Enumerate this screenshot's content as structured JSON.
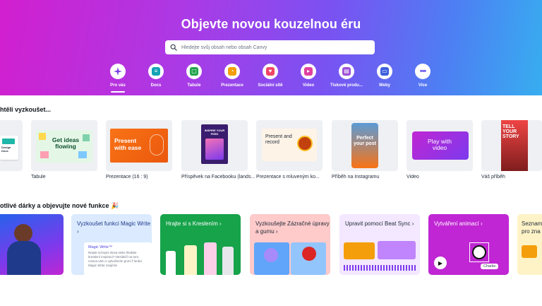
{
  "hero": {
    "title": "Objevte novou kouzelnou éru",
    "search_placeholder": "Hledejte svůj obsah nebo obsah Canvy"
  },
  "nav": [
    {
      "label": "Pro vás",
      "icon": "sparkle-icon",
      "color": "#7b3fe4"
    },
    {
      "label": "Docs",
      "icon": "docs-icon",
      "color": "#13a3b5"
    },
    {
      "label": "Tabule",
      "icon": "whiteboard-icon",
      "color": "#1fa34a"
    },
    {
      "label": "Prezentace",
      "icon": "presentation-icon",
      "color": "#f59e0b"
    },
    {
      "label": "Sociální sítě",
      "icon": "heart-icon",
      "color": "#ef4466"
    },
    {
      "label": "Video",
      "icon": "video-icon",
      "color": "#e040a0"
    },
    {
      "label": "Tiskové produ...",
      "icon": "print-icon",
      "color": "#9b4fd6"
    },
    {
      "label": "Weby",
      "icon": "website-icon",
      "color": "#3d5fdc"
    },
    {
      "label": "Více",
      "icon": "more-icon",
      "color": "#6b62e8"
    }
  ],
  "section1": {
    "title": "htěli vyzkoušet...",
    "cards": [
      {
        "label": "",
        "thumb_text": "Design Docs"
      },
      {
        "label": "Tabule",
        "thumb_text": "Get ideas flowing"
      },
      {
        "label": "Prezentace (16 : 9)",
        "thumb_text": "Present with ease"
      },
      {
        "label": "Příspěvek na Facebooku (lands...",
        "thumb_text": "INSPIRE YOUR FEED"
      },
      {
        "label": "Prezentace s mluveným ko...",
        "thumb_text": "Present and record"
      },
      {
        "label": "Příběh na Instagramu",
        "thumb_text": "Perfect your post"
      },
      {
        "label": "Video",
        "thumb_text": "Play with video"
      },
      {
        "label": "Váš příběh",
        "thumb_text": "TELL YOUR STORY"
      }
    ]
  },
  "section2": {
    "title": "otlivé dárky a objevujte nové funkce",
    "emoji": "🎉",
    "cards": [
      {
        "label": ""
      },
      {
        "label": "Vyzkoušet funkci Magic Write ›",
        "sub_title": "Magic Write™",
        "sub_text": "Nejste schopni slova nebo hledáte kreativní inspiraci? Nezáleží na tom, Canva vám s vytvořením první f funkci Magic Write zaujímá"
      },
      {
        "label": "Hrajte si s Kreslením ›"
      },
      {
        "label": "Vyzkoušejte Zázračné úpravy a gumu ›"
      },
      {
        "label": "Upravit pomocí Beat Sync ›"
      },
      {
        "label": "Vytváření animací ›",
        "tag": "Charlie"
      },
      {
        "label": "Seznam pro zna"
      }
    ]
  }
}
